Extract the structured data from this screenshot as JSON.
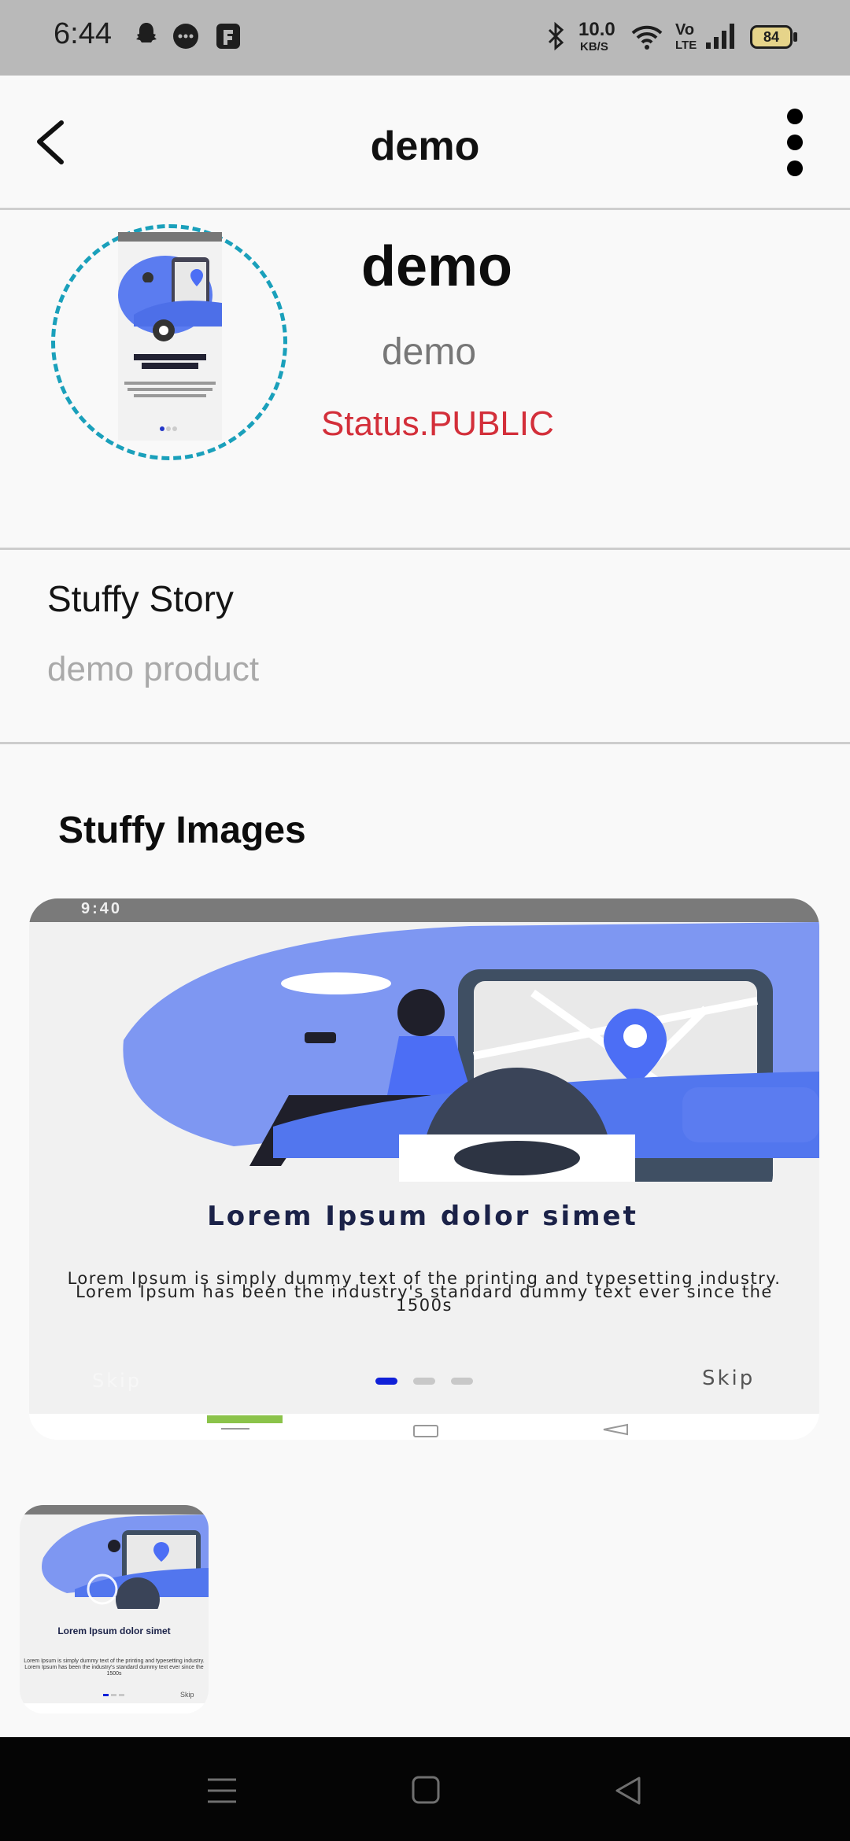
{
  "status_bar": {
    "time": "6:44",
    "network_speed": "10.0",
    "network_unit": "KB/S",
    "volte_top": "Vo",
    "volte_bottom": "LTE",
    "battery": "84"
  },
  "app_bar": {
    "title": "demo"
  },
  "product": {
    "name": "demo",
    "subtitle": "demo",
    "status": "Status.PUBLIC"
  },
  "story": {
    "heading": "Stuffy Story",
    "text": "demo product"
  },
  "images_section": {
    "heading": "Stuffy Images",
    "main_image": {
      "phone_time": "9:40",
      "title": "Lorem Ipsum dolor simet",
      "body": "Lorem Ipsum is simply dummy text of the printing and typesetting industry. Lorem Ipsum has been the industry's standard dummy text ever since the 1500s",
      "skip_left": "Skip",
      "skip_right": "Skip"
    },
    "thumbnail": {
      "title": "Lorem Ipsum dolor simet",
      "body": "Lorem Ipsum is simply dummy text of the printing and typesetting industry. Lorem Ipsum has been the industry's standard dummy text ever since the 1500s",
      "skip": "Skip"
    }
  },
  "colors": {
    "accent_ring": "#1aa0bb",
    "status_red": "#d32f3a",
    "illustration_blue": "#5b7cf0"
  }
}
